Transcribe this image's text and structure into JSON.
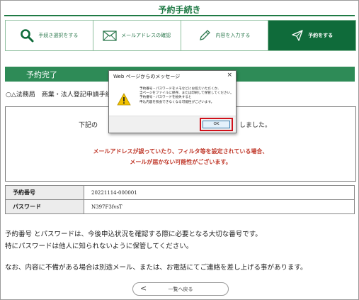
{
  "page": {
    "title": "予約手続き"
  },
  "steps": [
    {
      "label": "手続き選択をする",
      "icon": "search-icon"
    },
    {
      "label": "メールアドレスの確認",
      "icon": "envelope-icon"
    },
    {
      "label": "内容を入力する",
      "icon": "pencil-icon"
    },
    {
      "label": "予約をする",
      "icon": "send-icon",
      "active": true
    }
  ],
  "section": {
    "title": "予約完了"
  },
  "procedure": {
    "text": "○△法務局　商業・法人登記申請手続"
  },
  "message": {
    "line_left": "下記の",
    "line_right": "しました。",
    "warning_line1": "メールアドレスが誤っていたり、フィルタ等を設定されている場合、",
    "warning_line2": "メールが届かない可能性がございます。"
  },
  "info": {
    "rows": [
      {
        "key": "予約番号",
        "value": "20221114-000001"
      },
      {
        "key": "パスワード",
        "value": "N397F3fvsT"
      }
    ]
  },
  "notes": {
    "line1": "予約番号 とパスワードは、今後申込状況を確認する際に必要となる大切な番号です。",
    "line2": "特にパスワードは他人に知られないように保管してください。",
    "line3": "なお、内容に不備がある場合は別途メール、または、お電話にてご連絡を差し上げる事があります。"
  },
  "back_button": {
    "label": "一覧へ戻る",
    "chevron": "<"
  },
  "dialog": {
    "title": "Web ページからのメッセージ",
    "close": "×",
    "lines": [
      "予約番号・パスワードをメモなどにお控えいただくか、",
      "当ページをファイルに保存、または印刷して保管してください。",
      "予約番号・パスワードを紛失すると",
      "申込内容を照会できなくなる可能性がございます。"
    ],
    "ok_label": "OK",
    "highlight_color": "#d0101a"
  },
  "colors": {
    "brand_green": "#1f7a45",
    "active_step": "#0f6b3a",
    "warning_red": "#c0392b"
  }
}
